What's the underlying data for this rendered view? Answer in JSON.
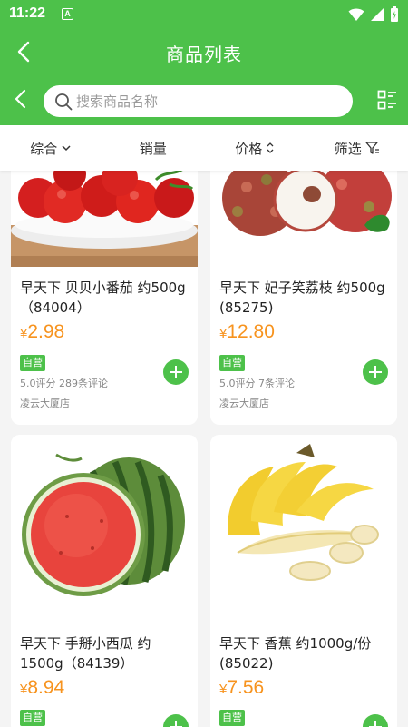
{
  "status_bar": {
    "time": "11:22",
    "notification_glyph": "A",
    "icons": [
      "wifi-icon",
      "signal-icon",
      "battery-icon"
    ]
  },
  "app_bar": {
    "title": "商品列表",
    "back_icon": "back-arrow-icon"
  },
  "search": {
    "placeholder": "搜索商品名称",
    "value": "",
    "layout_toggle_icon": "list-view-icon"
  },
  "filters": [
    {
      "label": "综合",
      "icon": "chevron-down-icon"
    },
    {
      "label": "销量",
      "icon": ""
    },
    {
      "label": "价格",
      "icon": "sort-arrows-icon"
    },
    {
      "label": "筛选",
      "icon": "filter-icon"
    }
  ],
  "products": [
    {
      "name": "早天下 贝贝小番茄 约500g（84004）",
      "currency": "¥",
      "price": "2.98",
      "tag": "自营",
      "rating": "5.0评分 289条评论",
      "store": "凌云大厦店",
      "image": "cherry-tomatoes"
    },
    {
      "name": "早天下 妃子笑荔枝 约500g (85275)",
      "currency": "¥",
      "price": "12.80",
      "tag": "自营",
      "rating": "5.0评分 7条评论",
      "store": "凌云大厦店",
      "image": "lychee"
    },
    {
      "name": "早天下 手掰小西瓜 约1500g（84139）",
      "currency": "¥",
      "price": "8.94",
      "tag": "自营",
      "rating": "",
      "store": "",
      "image": "watermelon"
    },
    {
      "name": "早天下 香蕉 约1000g/份(85022)",
      "currency": "¥",
      "price": "7.56",
      "tag": "自营",
      "rating": "",
      "store": "",
      "image": "banana"
    }
  ],
  "colors": {
    "brand_green": "#4dc14a",
    "price_orange": "#f7931e",
    "background": "#f4f4f4"
  }
}
